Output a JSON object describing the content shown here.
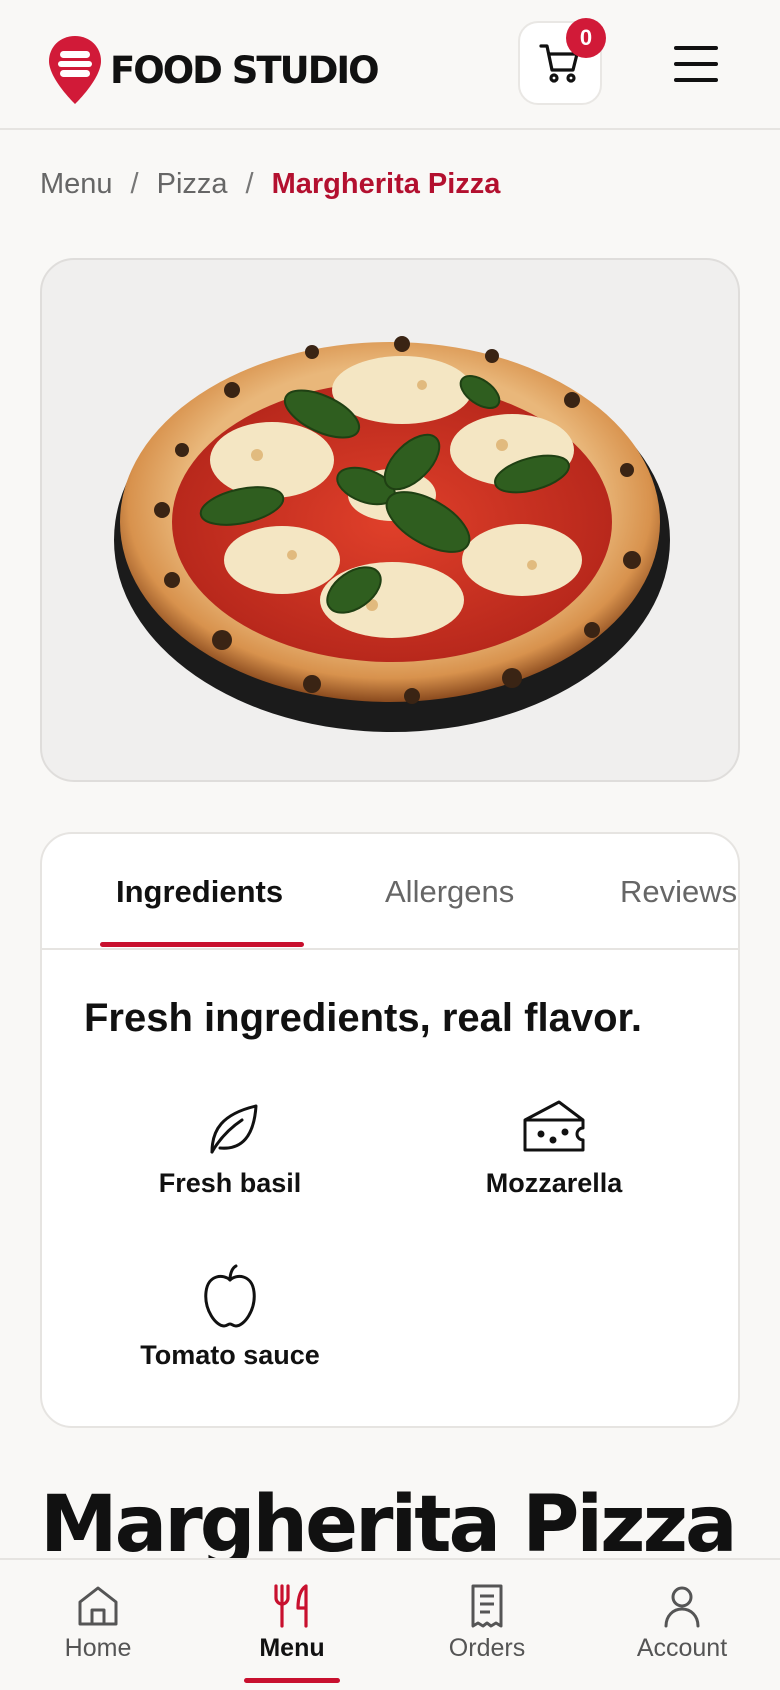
{
  "header": {
    "logo_text": "FOOD STUDIO",
    "cart_count": "0",
    "brand_color": "#d11a38"
  },
  "breadcrumb": {
    "items": [
      "Menu",
      "Pizza"
    ],
    "separator": "/",
    "current": "Margherita Pizza"
  },
  "product": {
    "image": "margherita-pizza-photo",
    "title": "Margherita Pizza"
  },
  "tabs": {
    "items": [
      {
        "label": "Ingredients",
        "active": true
      },
      {
        "label": "Allergens",
        "active": false
      },
      {
        "label": "Reviews",
        "active": false
      }
    ]
  },
  "ingredients": {
    "heading": "Fresh ingredients, real flavor.",
    "items": [
      {
        "icon": "leaf-icon",
        "label": "Fresh basil"
      },
      {
        "icon": "cheese-icon",
        "label": "Mozzarella"
      },
      {
        "icon": "apple-icon",
        "label": "Tomato sauce"
      }
    ]
  },
  "bottom_nav": {
    "items": [
      {
        "icon": "home-icon",
        "label": "Home",
        "active": false
      },
      {
        "icon": "fork-knife-icon",
        "label": "Menu",
        "active": true
      },
      {
        "icon": "receipt-icon",
        "label": "Orders",
        "active": false
      },
      {
        "icon": "user-icon",
        "label": "Account",
        "active": false
      }
    ]
  }
}
